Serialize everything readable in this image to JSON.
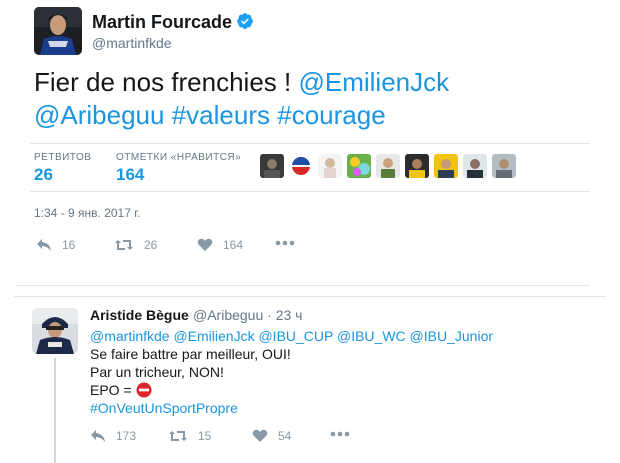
{
  "tweet": {
    "author_name": "Martin Fourcade",
    "author_handle": "@martinfkde",
    "text_plain": "Fier de nos frenchies ! ",
    "mention_1": "@EmilienJck",
    "mention_2": "@Aribeguu",
    "hashtag_1": "#valeurs",
    "hashtag_2": "#courage",
    "retweets_label": "РЕТВИТОВ",
    "retweets_count": "26",
    "likes_label": "ОТМЕТКИ «НРАВИТСЯ»",
    "likes_count": "164",
    "timestamp": "1:34 - 9 янв. 2017 г.",
    "actions": {
      "reply_count": "16",
      "retweet_count": "26",
      "like_count": "164"
    }
  },
  "reply": {
    "author_name": "Aristide Bègue",
    "author_handle": "@Aribeguu · 23 ч",
    "mentions_line": "@martinfkde @EmilienJck @IBU_CUP @IBU_WC @IBU_Junior",
    "line_1": "Se faire battre par meilleur, OUI!",
    "line_2": "Par un tricheur, NON!",
    "line_3": "EPO = ",
    "hashtag": "#OnVeutUnSportPropre",
    "actions": {
      "reply_count": "173",
      "retweet_count": "15",
      "like_count": "54"
    }
  },
  "colors": {
    "link": "#1b95e0",
    "muted": "#657786",
    "action": "#8899a6",
    "verified": "#1da1f2",
    "no_entry": "#e0242c"
  },
  "icons": {
    "verified": "verified-badge-icon",
    "reply": "reply-icon",
    "retweet": "retweet-icon",
    "like": "heart-icon",
    "more": "more-dots-icon",
    "no_entry": "no-entry-emoji-icon"
  }
}
